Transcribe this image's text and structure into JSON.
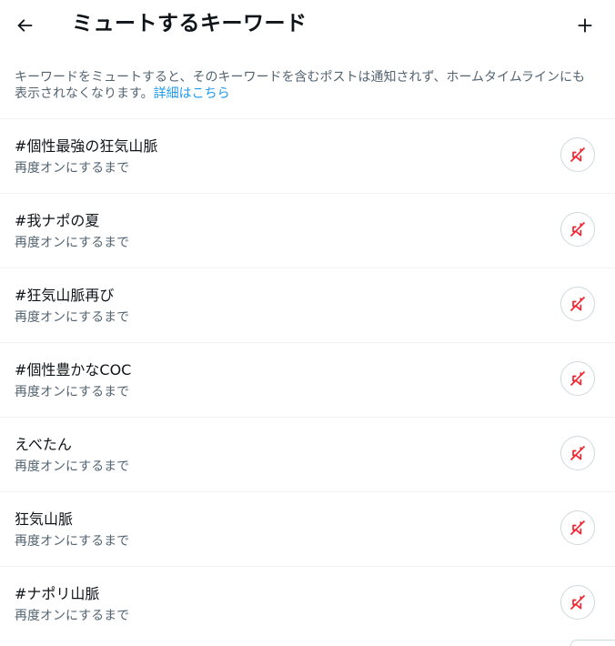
{
  "header": {
    "title": "ミュートするキーワード",
    "back_icon": "arrow-left-icon",
    "add_icon": "plus-icon"
  },
  "description": {
    "text": "キーワードをミュートすると、そのキーワードを含むポストは通知されず、ホームタイムラインにも表示されなくなります。",
    "link": "詳細はこちら"
  },
  "keywords": [
    {
      "keyword": "#個性最強の狂気山脈",
      "duration": "再度オンにするまで"
    },
    {
      "keyword": "#我ナポの夏",
      "duration": "再度オンにするまで"
    },
    {
      "keyword": "#狂気山脈再び",
      "duration": "再度オンにするまで"
    },
    {
      "keyword": "#個性豊かなCOC",
      "duration": "再度オンにするまで"
    },
    {
      "keyword": "えべたん",
      "duration": "再度オンにするまで"
    },
    {
      "keyword": "狂気山脈",
      "duration": "再度オンにするまで"
    },
    {
      "keyword": "#ナポリ山脈",
      "duration": "再度オンにするまで"
    }
  ],
  "colors": {
    "text_primary": "#0f1419",
    "text_secondary": "#536471",
    "link": "#1d9bf0",
    "muted_icon": "#f4212e",
    "divider": "#eff3f4"
  },
  "row_icon": "speaker-muted-icon"
}
